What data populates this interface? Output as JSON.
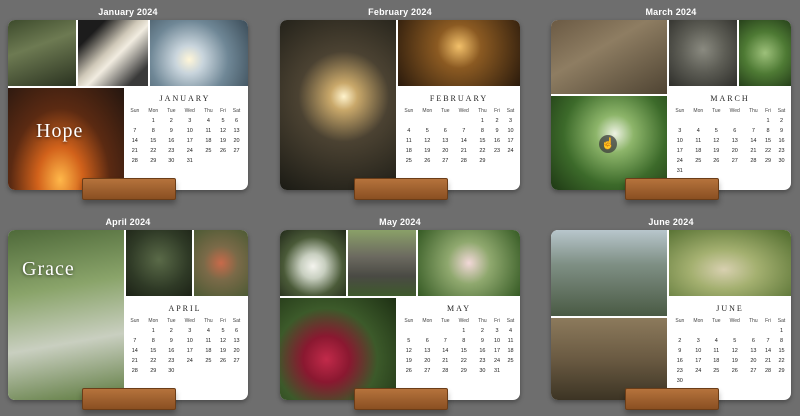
{
  "weekday_headers": [
    "Sun",
    "Mon",
    "Tue",
    "Wed",
    "Thu",
    "Fri",
    "Sat"
  ],
  "months": [
    {
      "title": "January 2024",
      "name": "JANUARY",
      "overlay": "Hope",
      "first_weekday": 1,
      "days": 31
    },
    {
      "title": "February 2024",
      "name": "FEBRUARY",
      "overlay": "",
      "first_weekday": 4,
      "days": 29
    },
    {
      "title": "March 2024",
      "name": "MARCH",
      "overlay": "",
      "first_weekday": 5,
      "days": 31
    },
    {
      "title": "April 2024",
      "name": "APRIL",
      "overlay": "Grace",
      "first_weekday": 1,
      "days": 30
    },
    {
      "title": "May 2024",
      "name": "MAY",
      "overlay": "",
      "first_weekday": 3,
      "days": 31
    },
    {
      "title": "June 2024",
      "name": "JUNE",
      "overlay": "",
      "first_weekday": 6,
      "days": 30
    }
  ],
  "cursor_icon": "hand-pointer-icon"
}
